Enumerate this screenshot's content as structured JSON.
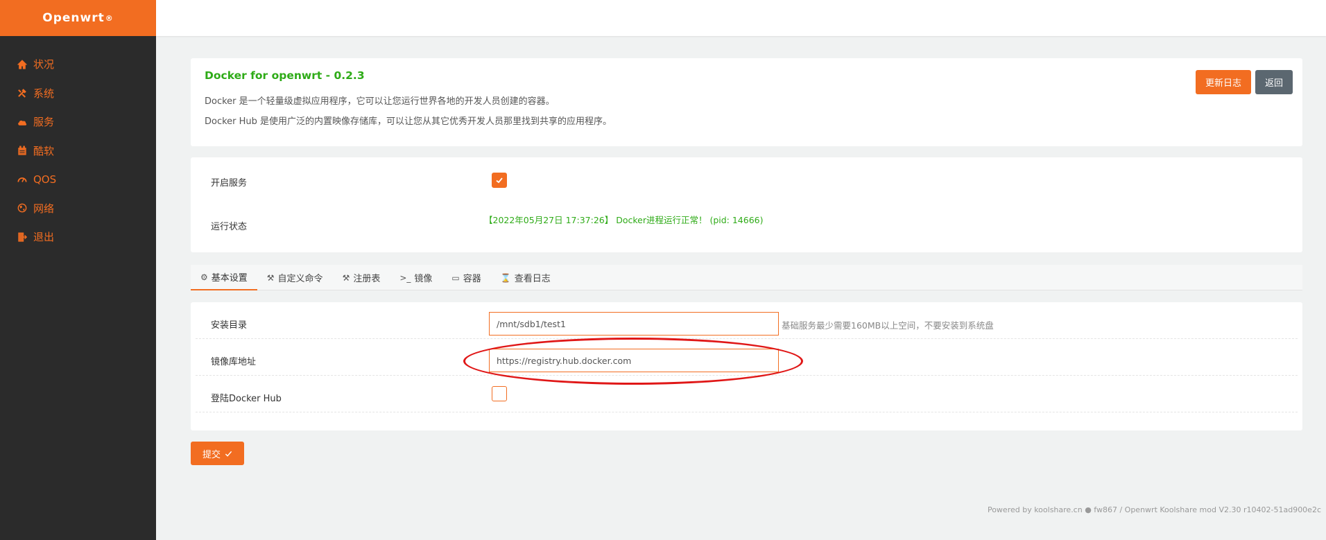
{
  "brand": {
    "name": "Openwrt",
    "mark": "®"
  },
  "sidebar": {
    "items": [
      {
        "label": "状况",
        "icon": "home-icon"
      },
      {
        "label": "系统",
        "icon": "tools-icon"
      },
      {
        "label": "服务",
        "icon": "cloud-icon"
      },
      {
        "label": "酷软",
        "icon": "calendar-icon"
      },
      {
        "label": "QOS",
        "icon": "gauge-icon"
      },
      {
        "label": "网络",
        "icon": "globe-icon"
      },
      {
        "label": "退出",
        "icon": "logout-icon"
      }
    ]
  },
  "header": {
    "title": "Docker for openwrt - 0.2.3",
    "desc1": "Docker 是一个轻量级虚拟应用程序，它可以让您运行世界各地的开发人员创建的容器。",
    "desc2": "Docker Hub 是使用广泛的内置映像存储库，可以让您从其它优秀开发人员那里找到共享的应用程序。",
    "changelog_label": "更新日志",
    "back_label": "返回"
  },
  "status": {
    "enable_label": "开启服务",
    "enabled": true,
    "run_label": "运行状态",
    "run_text": "【2022年05月27日 17:37:26】 Docker进程运行正常！  (pid: 14666)"
  },
  "tabs": [
    {
      "label": "基本设置",
      "icon": "gear-icon",
      "glyph": "⚙",
      "active": true
    },
    {
      "label": "自定义命令",
      "icon": "tools-icon",
      "glyph": "⚒",
      "active": false
    },
    {
      "label": "注册表",
      "icon": "tools-icon",
      "glyph": "⚒",
      "active": false
    },
    {
      "label": "镜像",
      "icon": "terminal-icon",
      "glyph": ">_",
      "active": false
    },
    {
      "label": "容器",
      "icon": "monitor-icon",
      "glyph": "▭",
      "active": false
    },
    {
      "label": "查看日志",
      "icon": "hourglass-icon",
      "glyph": "⌛",
      "active": false
    }
  ],
  "settings": {
    "install_dir_label": "安装目录",
    "install_dir_value": "/mnt/sdb1/test1",
    "install_dir_hint": "基础服务最少需要160MB以上空间，不要安装到系统盘",
    "registry_label": "镜像库地址",
    "registry_value": "https://registry.hub.docker.com",
    "login_label": "登陆Docker Hub",
    "login_checked": false
  },
  "submit_label": "提交",
  "footer": "Powered by koolshare.cn ● fw867 / Openwrt Koolshare mod V2.30 r10402-51ad900e2c",
  "colors": {
    "accent": "#f26d21",
    "success": "#2eab17",
    "sidebar": "#2b2b2b",
    "annotation": "#e01717"
  }
}
